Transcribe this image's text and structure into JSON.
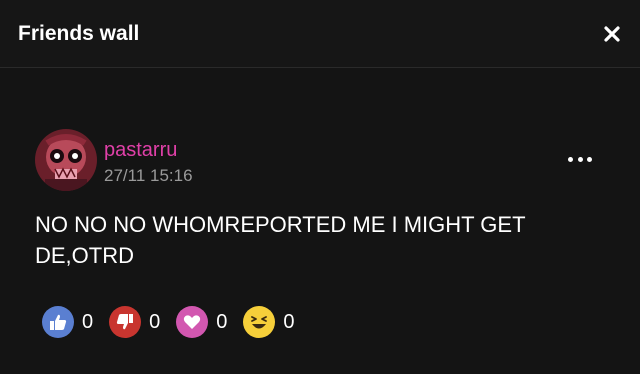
{
  "header": {
    "title": "Friends wall",
    "close_icon": "close-icon"
  },
  "post": {
    "username": "pastarru",
    "timestamp": "27/11 15:16",
    "text": "NO NO NO WHOMREPORTED ME I MIGHT GET DE,OTRD",
    "menu_icon": "more-icon"
  },
  "reactions": [
    {
      "icon": "thumbs-up-icon",
      "count": "0",
      "color": "#5a7fd1"
    },
    {
      "icon": "thumbs-down-icon",
      "count": "0",
      "color": "#c8352f"
    },
    {
      "icon": "heart-icon",
      "count": "0",
      "color": "#d257b0"
    },
    {
      "icon": "laughing-face-icon",
      "count": "0",
      "color": "#f6cf3a"
    }
  ],
  "colors": {
    "username": "#e040a8",
    "header_bg": "#161616",
    "panel_bg": "#141414"
  }
}
